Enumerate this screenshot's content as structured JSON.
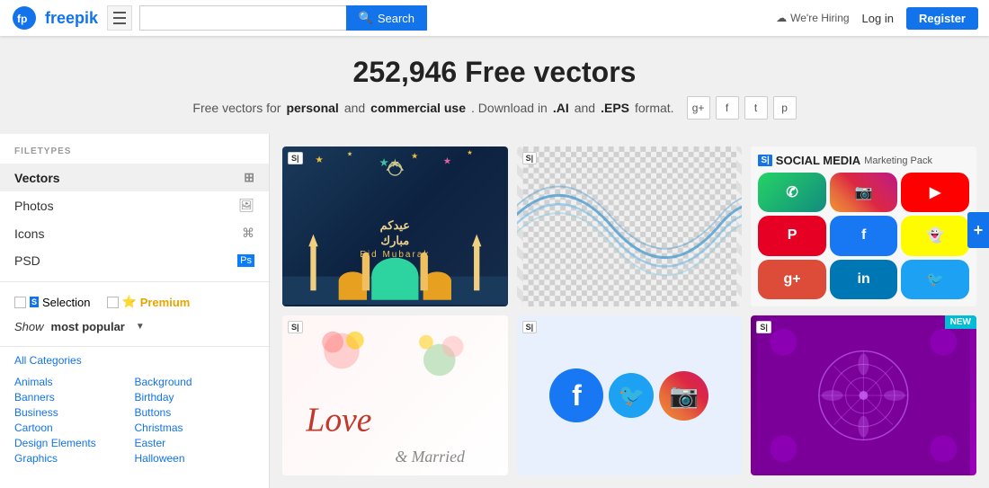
{
  "header": {
    "logo_text": "freepik",
    "search_placeholder": "",
    "search_button": "Search",
    "hiring_text": "We're Hiring",
    "login_text": "Log in",
    "register_text": "Register"
  },
  "hero": {
    "title": "252,946 Free vectors",
    "subtitle_start": "Free vectors for",
    "bold1": "personal",
    "subtitle_and": "and",
    "bold2": "commercial use",
    "subtitle_end": ". Download in",
    "bold3": ".AI",
    "subtitle_and2": "and",
    "bold4": ".EPS",
    "subtitle_format": "format."
  },
  "sidebar": {
    "section_label": "FILETYPES",
    "filetypes": [
      {
        "label": "Vectors",
        "icon": "⊞",
        "active": true
      },
      {
        "label": "Photos",
        "icon": "🖼",
        "active": false
      },
      {
        "label": "Icons",
        "icon": "⌘",
        "active": false
      },
      {
        "label": "PSD",
        "icon": "Ps",
        "active": false
      }
    ],
    "selection_label": "Selection",
    "premium_label": "Premium",
    "show_label": "Show",
    "most_popular": "most popular",
    "all_categories": "All Categories",
    "categories_left": [
      "Animals",
      "Banners",
      "Business",
      "Cartoon",
      "Design Elements",
      "Graphics"
    ],
    "categories_right": [
      "Background",
      "Birthday",
      "Buttons",
      "Christmas",
      "Easter",
      "Halloween"
    ]
  },
  "cards": [
    {
      "id": "eid-mubarak",
      "badge": "S",
      "type": "eid"
    },
    {
      "id": "wave-abstract",
      "badge": "S",
      "type": "wave"
    },
    {
      "id": "social-media",
      "badge": "S",
      "type": "social",
      "title": "SOCIAL MEDIA",
      "subtitle": "Marketing Pack"
    },
    {
      "id": "love-married",
      "badge": "S",
      "type": "love"
    },
    {
      "id": "facebook-social",
      "badge": "S",
      "type": "fb"
    },
    {
      "id": "purple-pattern",
      "badge": "S",
      "type": "purple",
      "new_label": "NEW"
    }
  ],
  "floating_btn": "+"
}
